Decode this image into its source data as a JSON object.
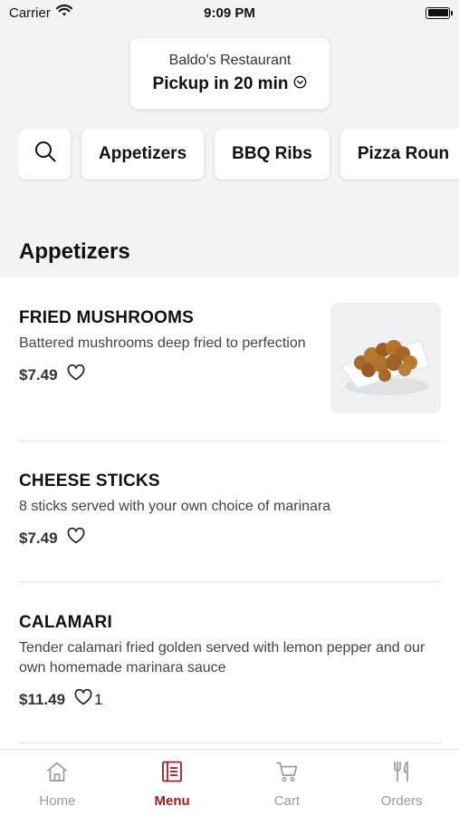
{
  "status_bar": {
    "carrier": "Carrier",
    "time": "9:09 PM"
  },
  "pickup": {
    "restaurant": "Baldo's Restaurant",
    "time_label": "Pickup in 20 min"
  },
  "categories": [
    "Appetizers",
    "BBQ Ribs",
    "Pizza Roun"
  ],
  "section_title": "Appetizers",
  "items": [
    {
      "name": "FRIED MUSHROOMS",
      "desc": "Battered mushrooms deep fried to perfection",
      "price": "$7.49",
      "likes": ""
    },
    {
      "name": "CHEESE STICKS",
      "desc": "8 sticks served with your own choice of marinara",
      "price": "$7.49",
      "likes": ""
    },
    {
      "name": "CALAMARI",
      "desc": "Tender calamari fried golden served with lemon pepper and our own homemade marinara sauce",
      "price": "$11.49",
      "likes": "1"
    }
  ],
  "tabs": [
    {
      "label": "Home",
      "icon": "home-icon"
    },
    {
      "label": "Menu",
      "icon": "menu-icon"
    },
    {
      "label": "Cart",
      "icon": "cart-icon"
    },
    {
      "label": "Orders",
      "icon": "utensils-icon"
    }
  ],
  "colors": {
    "accent": "#a61c1c",
    "background": "#f3f3f3",
    "inactive_tab": "#9a9a9a"
  }
}
